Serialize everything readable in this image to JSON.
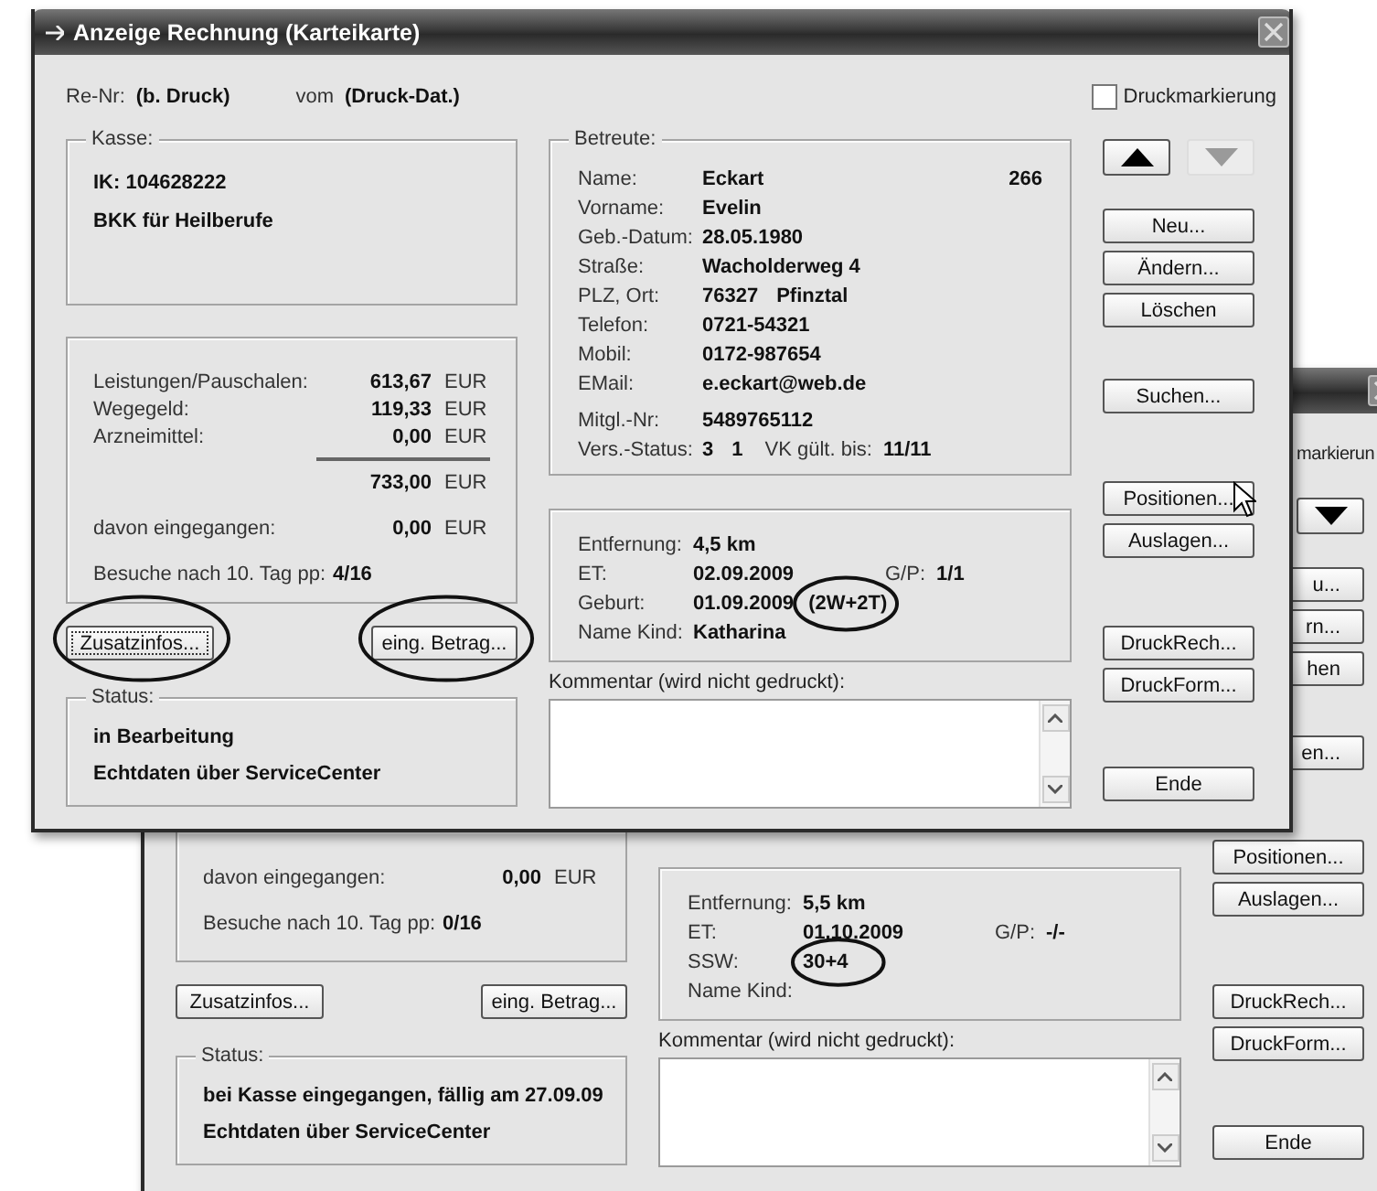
{
  "front_window": {
    "title": "Anzeige Rechnung (Karteikarte)",
    "invoice_no": {
      "label": "Re-Nr:",
      "value": "(b. Druck)"
    },
    "invoice_date": {
      "label": "vom",
      "value": "(Druck-Dat.)"
    },
    "print_mark": {
      "label": "Druckmarkierung",
      "checked": false
    },
    "kasse": {
      "legend": "Kasse:",
      "lines": [
        "IK: 104628222",
        "BKK für Heilberufe"
      ]
    },
    "amounts": [
      {
        "kind": "line",
        "label": "Leistungen/Pauschalen:",
        "value": "613,67",
        "unit": "EUR"
      },
      {
        "kind": "line",
        "label": "Wegegeld:",
        "value": "119,33",
        "unit": "EUR"
      },
      {
        "kind": "line",
        "label": "Arzneimittel:",
        "value": "0,00",
        "unit": "EUR"
      },
      {
        "kind": "sum",
        "value": "733,00",
        "unit": "EUR"
      },
      {
        "kind": "received",
        "label": "davon eingegangen:",
        "value": "0,00",
        "unit": "EUR"
      }
    ],
    "visits": {
      "label": "Besuche nach 10. Tag pp:",
      "value": "4/16"
    },
    "left_buttons": [
      {
        "label": "Zusatzinfos...",
        "focused": true,
        "circled": true
      },
      {
        "label": "eing. Betrag...",
        "focused": false,
        "circled": true
      }
    ],
    "status": {
      "legend": "Status:",
      "lines": [
        "in Bearbeitung",
        "Echtdaten über ServiceCenter"
      ]
    },
    "betreute": {
      "legend": "Betreute:",
      "number": "266",
      "rows": [
        {
          "label": "Name:",
          "values": [
            "Eckart"
          ]
        },
        {
          "label": "Vorname:",
          "values": [
            "Evelin"
          ]
        },
        {
          "label": "Geb.-Datum:",
          "values": [
            "28.05.1980"
          ]
        },
        {
          "label": "Straße:",
          "values": [
            "Wacholderweg 4"
          ]
        },
        {
          "label": "PLZ, Ort:",
          "values": [
            "76327",
            "Pfinztal"
          ]
        },
        {
          "label": "Telefon:",
          "values": [
            "0721-54321"
          ]
        },
        {
          "label": "Mobil:",
          "values": [
            "0172-987654"
          ]
        },
        {
          "label": "EMail:",
          "values": [
            "e.eckart@web.de"
          ]
        }
      ],
      "member_rows": [
        {
          "label": "Mitgl.-Nr:",
          "values": [
            "5489765112"
          ]
        },
        {
          "label": "Vers.-Status:",
          "values": [
            "3",
            "1"
          ],
          "extra": {
            "label": "VK gült. bis:",
            "value": "11/11"
          }
        }
      ]
    },
    "birth": {
      "rows": [
        {
          "label": "Entfernung:",
          "values": [
            "4,5 km"
          ]
        },
        {
          "label": "ET:",
          "values": [
            "02.09.2009"
          ],
          "extra": {
            "label": "G/P:",
            "value": "1/1"
          }
        },
        {
          "label": "Geburt:",
          "values": [
            "01.09.2009",
            "(2W+2T)"
          ],
          "circled": true
        },
        {
          "label": "Name Kind:",
          "values": [
            "Katharina"
          ]
        }
      ]
    },
    "comment": {
      "label": "Kommentar (wird nicht gedruckt):"
    },
    "nav": [
      {
        "kind": "up",
        "disabled": false
      },
      {
        "kind": "down",
        "disabled": true
      }
    ],
    "button_groups": [
      [
        "Neu...",
        "Ändern...",
        "Löschen"
      ],
      [
        "Suchen..."
      ],
      [
        "Positionen...",
        "Auslagen..."
      ],
      [
        "DruckRech...",
        "DruckForm..."
      ],
      [
        "Ende"
      ]
    ]
  },
  "back_window": {
    "print_mark_fragment": "markierun",
    "nav": [
      {
        "kind": "down",
        "disabled": false
      }
    ],
    "button_fragments": [
      "u...",
      "rn...",
      "hen",
      "en..."
    ],
    "amounts": [
      {
        "kind": "received",
        "label": "davon eingegangen:",
        "value": "0,00",
        "unit": "EUR"
      }
    ],
    "visits": {
      "label": "Besuche nach 10. Tag pp:",
      "value": "0/16"
    },
    "left_buttons": [
      {
        "label": "Zusatzinfos...",
        "focused": false,
        "circled": false
      },
      {
        "label": "eing. Betrag...",
        "focused": false,
        "circled": false
      }
    ],
    "status": {
      "legend": "Status:",
      "lines": [
        "bei Kasse eingegangen, fällig am 27.09.09",
        "Echtdaten über ServiceCenter"
      ]
    },
    "birth": {
      "rows": [
        {
          "label": "Entfernung:",
          "values": [
            "5,5 km"
          ]
        },
        {
          "label": "ET:",
          "values": [
            "01.10.2009"
          ],
          "extra": {
            "label": "G/P:",
            "value": "-/-"
          }
        },
        {
          "label": "SSW:",
          "values": [
            "30+4"
          ],
          "circled": true
        },
        {
          "label": "Name Kind:"
        }
      ]
    },
    "comment": {
      "label": "Kommentar (wird nicht gedruckt):"
    },
    "button_groups": [
      [
        "Positionen...",
        "Auslagen..."
      ],
      [
        "DruckRech...",
        "DruckForm..."
      ],
      [
        "Ende"
      ]
    ]
  }
}
